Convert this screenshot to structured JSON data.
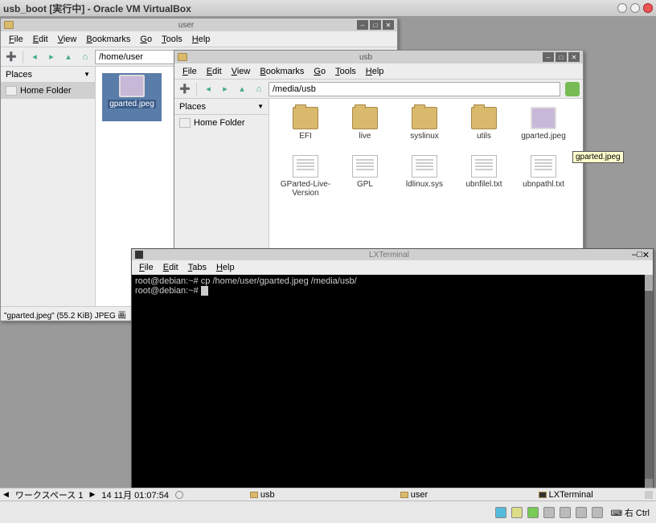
{
  "vbox": {
    "title": "usb_boot [実行中] - Oracle VM VirtualBox",
    "right_ctrl": "右 Ctrl"
  },
  "menus": {
    "file": "File",
    "edit": "Edit",
    "view": "View",
    "bookmarks": "Bookmarks",
    "go": "Go",
    "tools": "Tools",
    "help": "Help"
  },
  "fm1": {
    "title": "user",
    "path": "/home/user",
    "places": "Places",
    "home": "Home Folder",
    "status": "\"gparted.jpeg\" (55.2 KiB) JPEG 画",
    "files": [
      {
        "name": "gparted.jpeg",
        "type": "img",
        "selected": true
      }
    ]
  },
  "fm2": {
    "title": "usb",
    "path": "/media/usb",
    "places": "Places",
    "home": "Home Folder",
    "files": [
      {
        "name": "EFI",
        "type": "folder"
      },
      {
        "name": "live",
        "type": "folder"
      },
      {
        "name": "syslinux",
        "type": "folder"
      },
      {
        "name": "utils",
        "type": "folder"
      },
      {
        "name": "gparted.jpeg",
        "type": "img"
      },
      {
        "name": "GParted-Live-Version",
        "type": "txt"
      },
      {
        "name": "GPL",
        "type": "txt"
      },
      {
        "name": "ldlinux.sys",
        "type": "txt"
      },
      {
        "name": "ubnfilel.txt",
        "type": "txt"
      },
      {
        "name": "ubnpathl.txt",
        "type": "txt"
      }
    ]
  },
  "terminal": {
    "title": "LXTerminal",
    "menus": {
      "file": "File",
      "edit": "Edit",
      "tabs": "Tabs",
      "help": "Help"
    },
    "lines": [
      "root@debian:~# cp /home/user/gparted.jpeg /media/usb/",
      "root@debian:~# "
    ]
  },
  "tooltip": "gparted.jpeg",
  "taskbar": {
    "workspace": "ワークスペース 1",
    "datetime": "14 11月   01:07:54",
    "task1": "usb",
    "task2": "user",
    "task3": "LXTerminal"
  }
}
